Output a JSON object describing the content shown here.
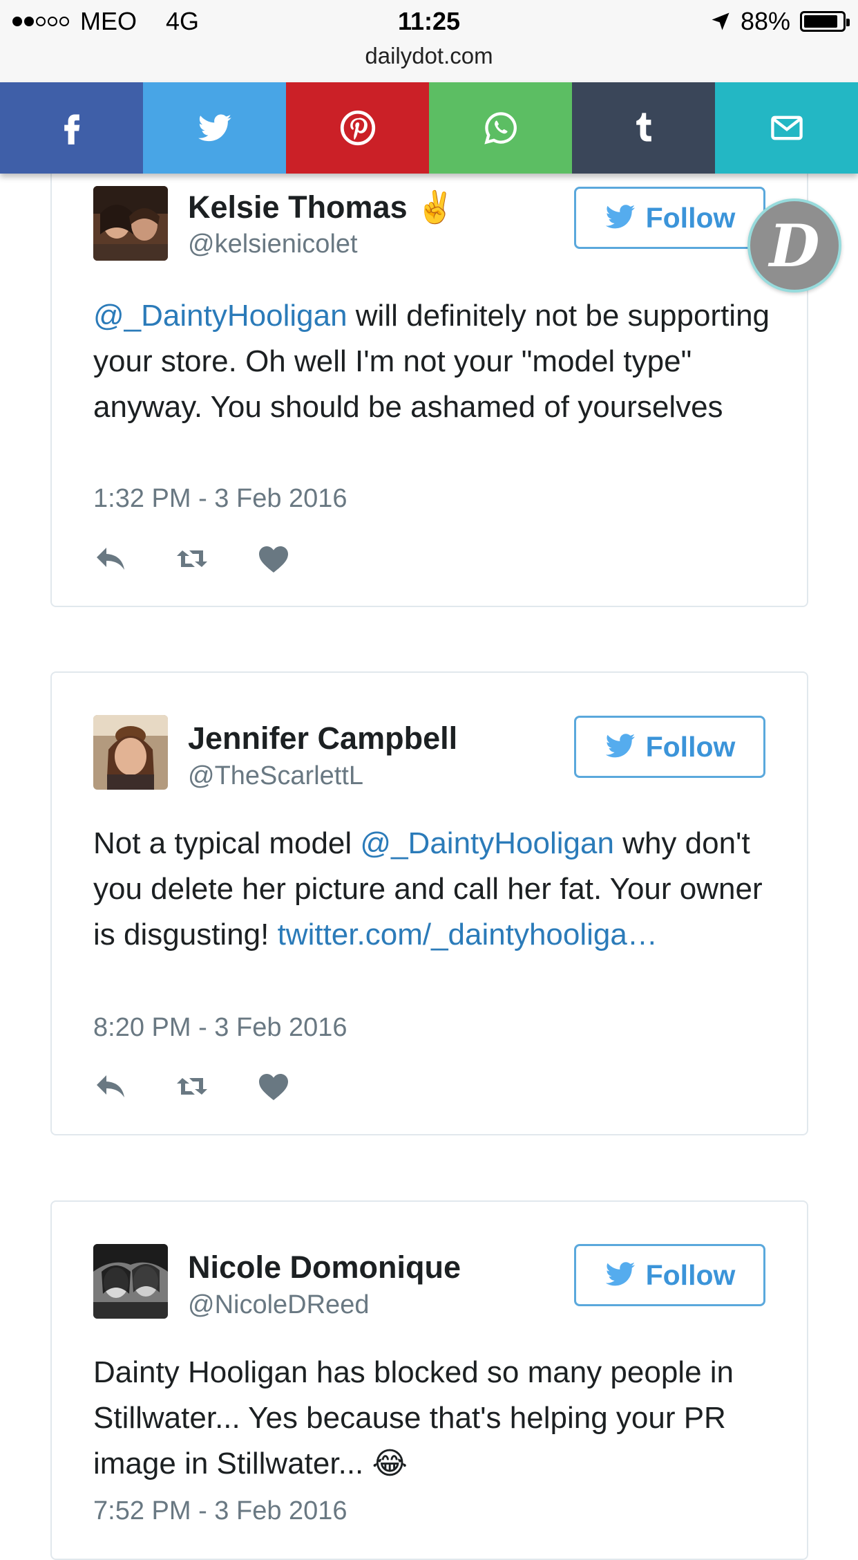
{
  "status_bar": {
    "carrier": "MEO",
    "network": "4G",
    "time": "11:25",
    "battery": "88%",
    "battery_level": 0.88,
    "signal_bars": 2,
    "signal_total": 5,
    "url": "dailydot.com"
  },
  "share_bar": {
    "items": [
      {
        "name": "facebook",
        "icon": "facebook-icon",
        "color": "#3f5fa8"
      },
      {
        "name": "twitter",
        "icon": "twitter-icon",
        "color": "#48a5e6"
      },
      {
        "name": "pinterest",
        "icon": "pinterest-icon",
        "color": "#cb2027"
      },
      {
        "name": "whatsapp",
        "icon": "whatsapp-icon",
        "color": "#5cbe63"
      },
      {
        "name": "tumblr",
        "icon": "tumblr-icon",
        "color": "#3a4659"
      },
      {
        "name": "email",
        "icon": "email-icon",
        "color": "#23b7c4"
      }
    ]
  },
  "badge": {
    "letter": "D"
  },
  "tweets": [
    {
      "name": "Kelsie Thomas",
      "name_emoji": "✌️",
      "handle": "@kelsienicolet",
      "follow_label": "Follow",
      "text_parts": [
        {
          "text": "@_DaintyHooligan",
          "type": "mention"
        },
        {
          "text": " will definitely not be supporting your store. Oh well I'm not your \"model type\" anyway. You should be ashamed of yourselves",
          "type": "text"
        }
      ],
      "time": "1:32 PM - 3 Feb 2016"
    },
    {
      "name": "Jennifer Campbell",
      "name_emoji": "",
      "handle": "@TheScarlettL",
      "follow_label": "Follow",
      "text_parts": [
        {
          "text": "Not a typical model ",
          "type": "text"
        },
        {
          "text": "@_DaintyHooligan",
          "type": "mention"
        },
        {
          "text": " why don't you delete her picture and call her fat. Your owner is disgusting! ",
          "type": "text"
        },
        {
          "text": "twitter.com/_daintyhooliga…",
          "type": "link"
        }
      ],
      "time": "8:20 PM - 3 Feb 2016"
    },
    {
      "name": "Nicole Domonique",
      "name_emoji": "",
      "handle": "@NicoleDReed",
      "follow_label": "Follow",
      "text_parts": [
        {
          "text": "Dainty Hooligan has blocked so many people in Stillwater... Yes because that's helping your PR image in Stillwater... 😂",
          "type": "text"
        }
      ],
      "time": "7:52 PM - 3 Feb 2016"
    }
  ]
}
